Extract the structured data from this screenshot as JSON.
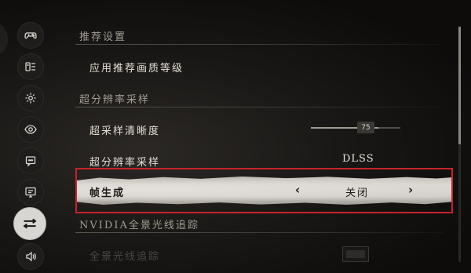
{
  "sections": [
    {
      "header": "推荐设置",
      "rows": [
        {
          "label": "应用推荐画质等级"
        }
      ]
    },
    {
      "header": "超分辨率采样",
      "rows": [
        {
          "label": "超采样清晰度",
          "slider_value": "75",
          "slider_fraction": 0.75
        },
        {
          "label": "超分辨率采样",
          "value": "DLSS"
        },
        {
          "label": "帧生成",
          "value": "关闭",
          "prev_arrow": "‹",
          "next_arrow": "›"
        }
      ]
    },
    {
      "header": "NVIDIA全景光线追踪",
      "rows": [
        {
          "label": "全景光线追踪"
        }
      ]
    }
  ],
  "sidebar": {
    "items": [
      {
        "icon": "gamepad-icon"
      },
      {
        "icon": "controller-layout-icon"
      },
      {
        "icon": "gear-icon"
      },
      {
        "icon": "eye-icon"
      },
      {
        "icon": "chat-icon"
      },
      {
        "icon": "monitor-icon"
      },
      {
        "icon": "sliders-icon",
        "active": true
      },
      {
        "icon": "speaker-icon"
      }
    ]
  },
  "colors": {
    "highlight_border": "#c8232b",
    "background": "#1a1816",
    "text": "#e4dfd6"
  }
}
